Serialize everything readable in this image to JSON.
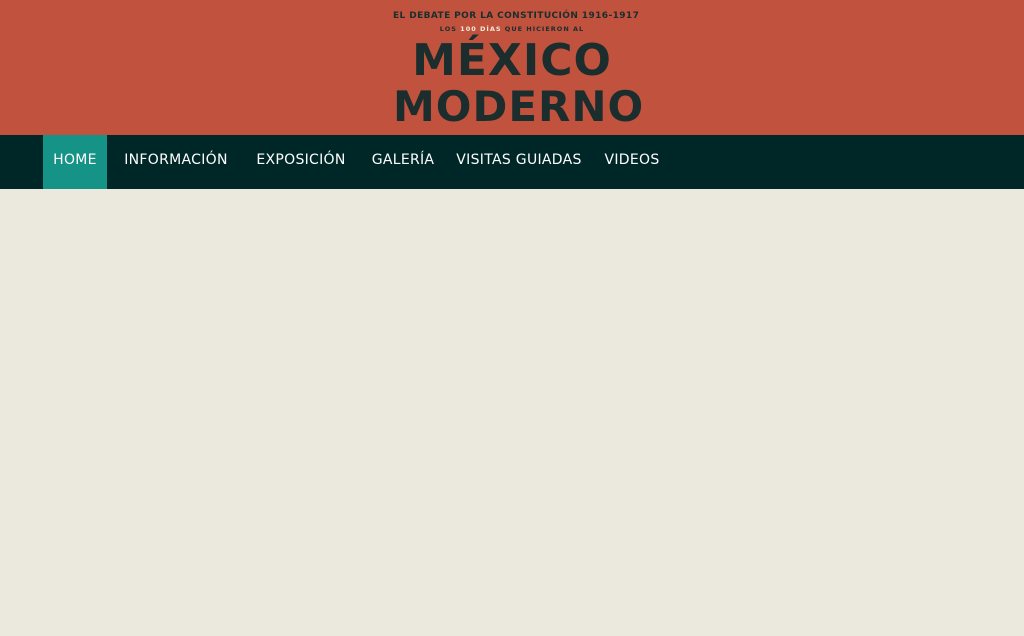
{
  "header": {
    "logo": {
      "line1": "EL DEBATE POR LA CONSTITUCIÓN 1916-1917",
      "line2_pre": "LOS ",
      "line2_hl": "100 DÍAS",
      "line2_post": " QUE HICIERON AL",
      "word1": "MÉXICO",
      "word2": "MODERNO"
    }
  },
  "nav": {
    "items": [
      {
        "label": "HOME",
        "active": true
      },
      {
        "label": "INFORMACIÓN",
        "active": false
      },
      {
        "label": "EXPOSICIÓN",
        "active": false
      },
      {
        "label": "GALERÍA",
        "active": false
      },
      {
        "label": "VISITAS GUIADAS",
        "active": false
      },
      {
        "label": "VIDEOS",
        "active": false
      }
    ]
  },
  "colors": {
    "header_bg": "#c1533e",
    "nav_bg": "#002727",
    "nav_active_bg": "#149386",
    "page_bg": "#ebe9dd",
    "logo_dark": "#1c2d2d",
    "logo_accent": "#6aa596"
  }
}
